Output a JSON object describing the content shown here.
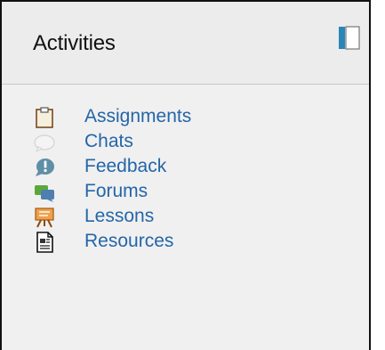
{
  "block": {
    "title": "Activities",
    "dock_icon": "dock-sidebar-icon",
    "items": [
      {
        "label": "Assignments",
        "icon": "clipboard-icon"
      },
      {
        "label": "Chats",
        "icon": "chat-bubble-icon"
      },
      {
        "label": "Feedback",
        "icon": "feedback-icon"
      },
      {
        "label": "Forums",
        "icon": "forum-icon"
      },
      {
        "label": "Lessons",
        "icon": "lesson-easel-icon"
      },
      {
        "label": "Resources",
        "icon": "document-icon"
      }
    ]
  },
  "colors": {
    "link": "#2466a8",
    "background": "#f0f0f0",
    "dock_accent": "#2a86b8"
  }
}
